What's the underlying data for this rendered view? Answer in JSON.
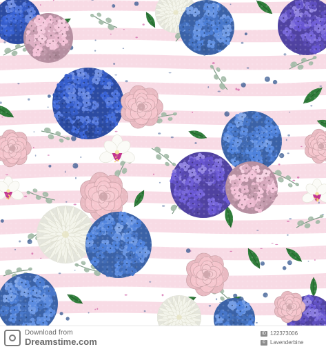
{
  "image": {
    "subject": "Seamless floral pattern with blue, violet and pink hydrangeas, pink roses and ranunculus, white chrysanthemums, white orchids and eucalyptus greenery over pink watercolor stripes",
    "colors": {
      "background": "#ffffff",
      "stripe": "#f6cfdc",
      "hydrangea_blue": "#4f83de",
      "hydrangea_royal": "#3a64d8",
      "hydrangea_violet": "#6a58d6",
      "hydrangea_pink": "#f3bfd6",
      "rose_pink": "#f5c4cc",
      "chrysanthemum_white": "#f3f4ea",
      "orchid_accent": "#c2368f",
      "eucalyptus": "#9fb8a4",
      "leaf_dark": "#2f7d3a",
      "berry": "#3f5f95"
    }
  },
  "watermark": {
    "brand_label": "Download from",
    "site": "Dreamstime.com",
    "image_id": "122373006",
    "author": "Lavenderbine"
  }
}
